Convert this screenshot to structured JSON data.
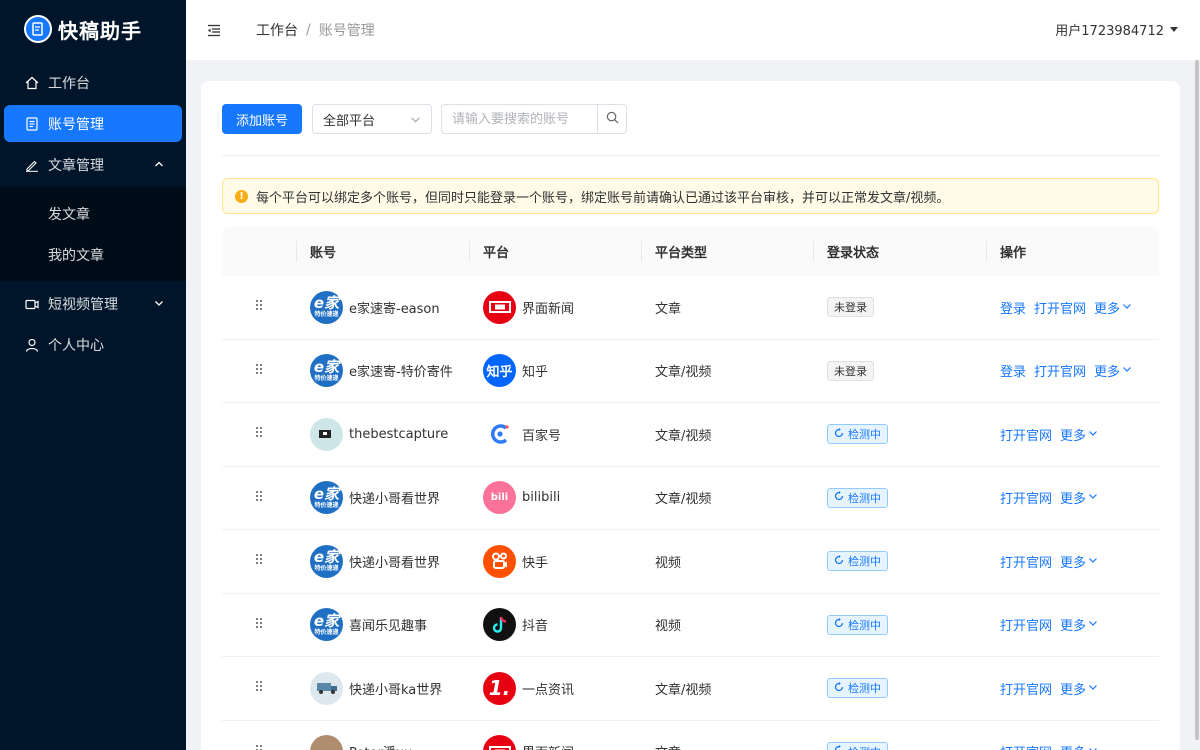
{
  "app": {
    "logo_text": "快稿助手"
  },
  "sidebar": {
    "items": [
      {
        "label": "工作台",
        "icon": "home-icon"
      },
      {
        "label": "账号管理",
        "icon": "account-icon",
        "active": true
      },
      {
        "label": "文章管理",
        "icon": "edit-icon",
        "expanded": true
      }
    ],
    "article_sub": [
      {
        "label": "发文章"
      },
      {
        "label": "我的文章"
      }
    ],
    "items2": [
      {
        "label": "短视频管理",
        "icon": "video-icon"
      },
      {
        "label": "个人中心",
        "icon": "user-icon"
      }
    ]
  },
  "header": {
    "breadcrumb_home": "工作台",
    "breadcrumb_sep": "/",
    "breadcrumb_current": "账号管理",
    "user": "用户1723984712"
  },
  "toolbar": {
    "add_label": "添加账号",
    "platform_select": "全部平台",
    "search_placeholder": "请输入要搜索的账号"
  },
  "alert": {
    "text": "每个平台可以绑定多个账号，但同时只能登录一个账号，绑定账号前请确认已通过该平台审核，并可以正常发文章/视频。"
  },
  "table": {
    "headers": {
      "account": "账号",
      "platform": "平台",
      "type": "平台类型",
      "status": "登录状态",
      "actions": "操作"
    },
    "rows": [
      {
        "account": "e家速寄-eason",
        "avatar": "e-home",
        "platform": "界面新闻",
        "plat_icon": "jiemian",
        "type": "文章",
        "status": "未登录",
        "status_kind": "gray",
        "actions": [
          "登录",
          "打开官网",
          "更多"
        ]
      },
      {
        "account": "e家速寄-特价寄件",
        "avatar": "e-home",
        "platform": "知乎",
        "plat_icon": "zhihu",
        "type": "文章/视频",
        "status": "未登录",
        "status_kind": "gray",
        "actions": [
          "登录",
          "打开官网",
          "更多"
        ]
      },
      {
        "account": "thebestcapture",
        "avatar": "capture",
        "platform": "百家号",
        "plat_icon": "baijia",
        "type": "文章/视频",
        "status": "检测中",
        "status_kind": "blue",
        "actions": [
          "打开官网",
          "更多"
        ]
      },
      {
        "account": "快递小哥看世界",
        "avatar": "e-home",
        "platform": "bilibili",
        "plat_icon": "bilibili",
        "type": "文章/视频",
        "status": "检测中",
        "status_kind": "blue",
        "actions": [
          "打开官网",
          "更多"
        ]
      },
      {
        "account": "快递小哥看世界",
        "avatar": "e-home",
        "platform": "快手",
        "plat_icon": "kuaishou",
        "type": "视频",
        "status": "检测中",
        "status_kind": "blue",
        "actions": [
          "打开官网",
          "更多"
        ]
      },
      {
        "account": "喜闻乐见趣事",
        "avatar": "e-home",
        "platform": "抖音",
        "plat_icon": "douyin",
        "type": "视频",
        "status": "检测中",
        "status_kind": "blue",
        "actions": [
          "打开官网",
          "更多"
        ]
      },
      {
        "account": "快递小哥ka世界",
        "avatar": "truck",
        "platform": "一点资讯",
        "plat_icon": "yidian",
        "type": "文章/视频",
        "status": "检测中",
        "status_kind": "blue",
        "actions": [
          "打开官网",
          "更多"
        ]
      },
      {
        "account": "Peter潘uu",
        "avatar": "person",
        "platform": "界面新闻",
        "plat_icon": "jiemian",
        "type": "文章",
        "status": "检测中",
        "status_kind": "blue",
        "actions": [
          "打开官网",
          "更多"
        ]
      }
    ]
  },
  "colors": {
    "primary": "#1677ff",
    "sidebar_bg": "#001529",
    "warning": "#faad14"
  }
}
